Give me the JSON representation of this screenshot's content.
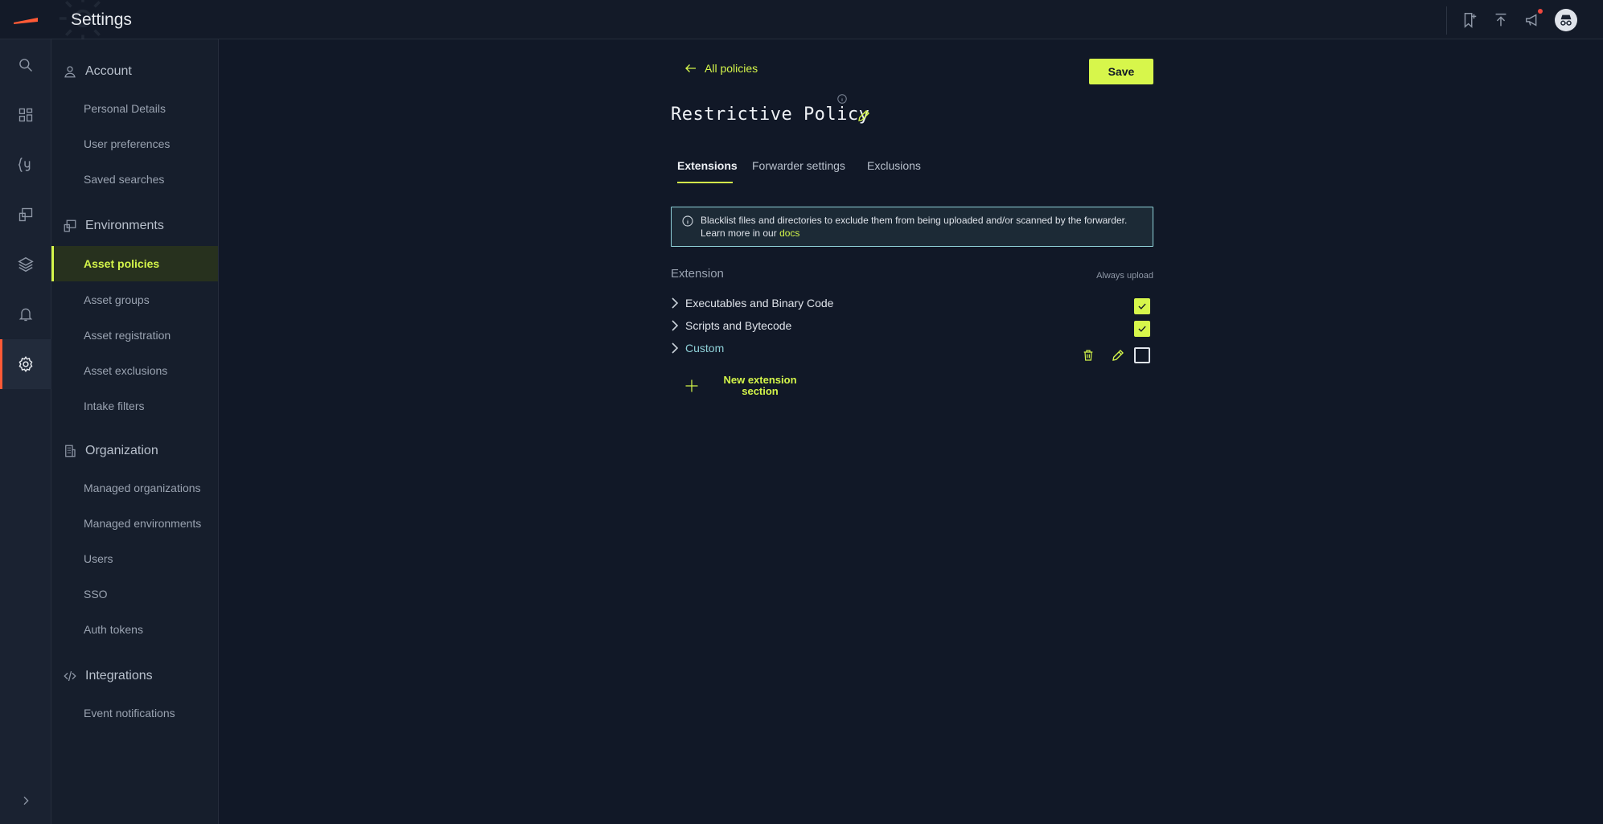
{
  "app": {
    "title": "Settings"
  },
  "rail": {
    "items": [
      "search-icon",
      "dashboard-icon",
      "query-icon",
      "assets-icon",
      "layers-icon",
      "bell-icon",
      "gear-icon"
    ],
    "expand": "chevron-right-icon"
  },
  "sidebar": {
    "sections": [
      {
        "title": "Account",
        "icon": "user-icon",
        "items": [
          "Personal Details",
          "User preferences",
          "Saved searches"
        ]
      },
      {
        "title": "Environments",
        "icon": "environment-icon",
        "items": [
          "Asset policies",
          "Asset groups",
          "Asset registration",
          "Asset exclusions",
          "Intake filters"
        ]
      },
      {
        "title": "Organization",
        "icon": "building-icon",
        "items": [
          "Managed organizations",
          "Managed environments",
          "Users",
          "SSO",
          "Auth tokens"
        ]
      },
      {
        "title": "Integrations",
        "icon": "code-icon",
        "items": [
          "Event notifications"
        ]
      }
    ],
    "active_item": "Asset policies"
  },
  "main": {
    "back_label": "All policies",
    "save_label": "Save",
    "policy_title": "Restrictive Policy",
    "tabs": [
      {
        "label": "Extensions",
        "active": true
      },
      {
        "label": "Forwarder settings",
        "active": false
      },
      {
        "label": "Exclusions",
        "active": false
      }
    ],
    "banner": {
      "line1": "Blacklist files and directories to exclude them from being uploaded and/or scanned by the forwarder.",
      "line2_prefix": "Learn more in our",
      "link": "docs"
    },
    "extension_header": "Extension",
    "always_upload_header": "Always upload",
    "extensions": [
      {
        "label": "Executables and Binary Code",
        "always_upload": true
      },
      {
        "label": "Scripts and Bytecode",
        "always_upload": true
      },
      {
        "label": "Custom",
        "always_upload": false
      }
    ],
    "new_section_label": "New extension section"
  },
  "colors": {
    "accent": "#d7f64b",
    "brand": "#ff5a36",
    "info_border": "#8fd1d8",
    "background": "#111827"
  }
}
